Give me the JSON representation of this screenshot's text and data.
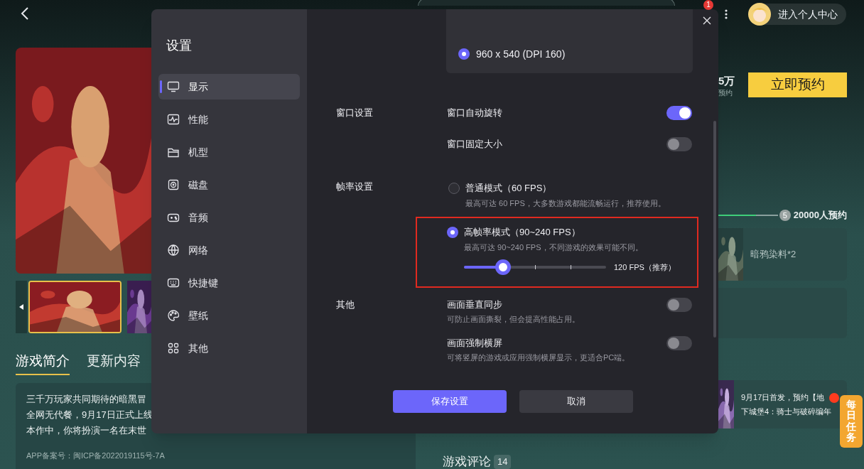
{
  "page": {
    "notification_count": "1",
    "user_button": "进入个人中心",
    "tabs": [
      {
        "label": "游戏简介",
        "selected": true
      },
      {
        "label": "更新内容",
        "selected": false
      }
    ],
    "description_lines": [
      "三千万玩家共同期待的暗黑冒",
      "全网无代餐，9月17日正式上线",
      "本作中，你将扮演一名在末世"
    ],
    "icp": "APP备案号：闽ICP备2022019115号-7A",
    "reserve_count": "5万",
    "reserve_label": "预约",
    "reserve_button": "立即预约",
    "milestone": {
      "level": 0.63,
      "badge": "5",
      "label": "20000人预约"
    },
    "reward": "暗鸦染料*2",
    "news": [
      "9月17日首发，预约【地",
      "下城堡4：骑士与破碎编年"
    ],
    "comments": {
      "title": "游戏评论",
      "count": "14"
    },
    "daily_task": "每日任务"
  },
  "settings": {
    "title": "设置",
    "nav": [
      {
        "label": "显示",
        "selected": true
      },
      {
        "label": "性能",
        "selected": false
      },
      {
        "label": "机型",
        "selected": false
      },
      {
        "label": "磁盘",
        "selected": false
      },
      {
        "label": "音频",
        "selected": false
      },
      {
        "label": "网络",
        "selected": false
      },
      {
        "label": "快捷键",
        "selected": false
      },
      {
        "label": "壁纸",
        "selected": false
      },
      {
        "label": "其他",
        "selected": false
      }
    ],
    "resolution": {
      "label": "960 x 540 (DPI 160)",
      "selected": true
    },
    "sections": [
      {
        "label": "窗口设置",
        "items": [
          {
            "kind": "toggle",
            "label": "窗口自动旋转",
            "on": true
          },
          {
            "kind": "toggle",
            "label": "窗口固定大小",
            "on": false
          }
        ]
      },
      {
        "label": "帧率设置",
        "items": [
          {
            "kind": "radio",
            "label": "普通模式（60 FPS）",
            "description": "最高可达 60 FPS，大多数游戏都能流畅运行，推荐使用。",
            "selected": false
          },
          {
            "kind": "radio",
            "label": "高帧率模式（90~240 FPS）",
            "description": "最高可达 90~240 FPS，不同游戏的效果可能不同。",
            "selected": true,
            "highlighted": true,
            "slider": {
              "level": 0.275,
              "reading": "120 FPS（推荐）"
            }
          }
        ]
      },
      {
        "label": "其他",
        "items": [
          {
            "kind": "toggle",
            "label": "画面垂直同步",
            "description": "可防止画面撕裂，但会提高性能占用。",
            "on": false
          },
          {
            "kind": "toggle",
            "label": "画面强制横屏",
            "description": "可将竖屏的游戏或应用强制横屏显示，更适合PC端。",
            "on": false
          }
        ]
      }
    ],
    "buttons": [
      {
        "label": "保存设置",
        "kind": "primary"
      },
      {
        "label": "取消",
        "kind": "secondary"
      }
    ]
  }
}
